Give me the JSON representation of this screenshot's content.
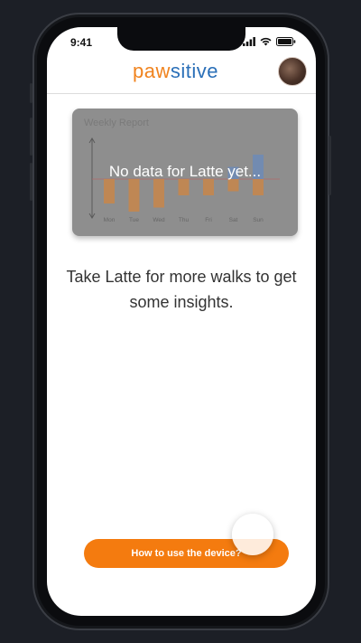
{
  "status_bar": {
    "time": "9:41",
    "icons": [
      "signal-icon",
      "wifi-icon",
      "battery-icon"
    ]
  },
  "header": {
    "logo_part1": "paw",
    "logo_part2": "sitive",
    "logo_colors": {
      "paw": "#f0831e",
      "sitive": "#2a6fb8"
    },
    "avatar": "pet-avatar"
  },
  "report": {
    "title": "Weekly Report",
    "overlay_message": "No data for Latte yet..."
  },
  "chart_data": {
    "type": "bar",
    "title": "Weekly Report",
    "categories": [
      "Mon",
      "Tue",
      "Wed",
      "Thu",
      "Fri",
      "Sat",
      "Sun"
    ],
    "values": [
      -3,
      -4,
      -3.5,
      -2,
      -2,
      1.5,
      3
    ],
    "secondary_values": [
      null,
      null,
      null,
      null,
      null,
      -1.5,
      -2
    ],
    "colors": {
      "negative": "#c8864a",
      "positive": "#6d8bb7"
    },
    "ylim": [
      -5,
      5
    ],
    "grid": false
  },
  "main": {
    "insight_text": "Take Latte for more walks to get some insights."
  },
  "cta": {
    "label": "How to use the device?",
    "color": "#f47b0f"
  }
}
